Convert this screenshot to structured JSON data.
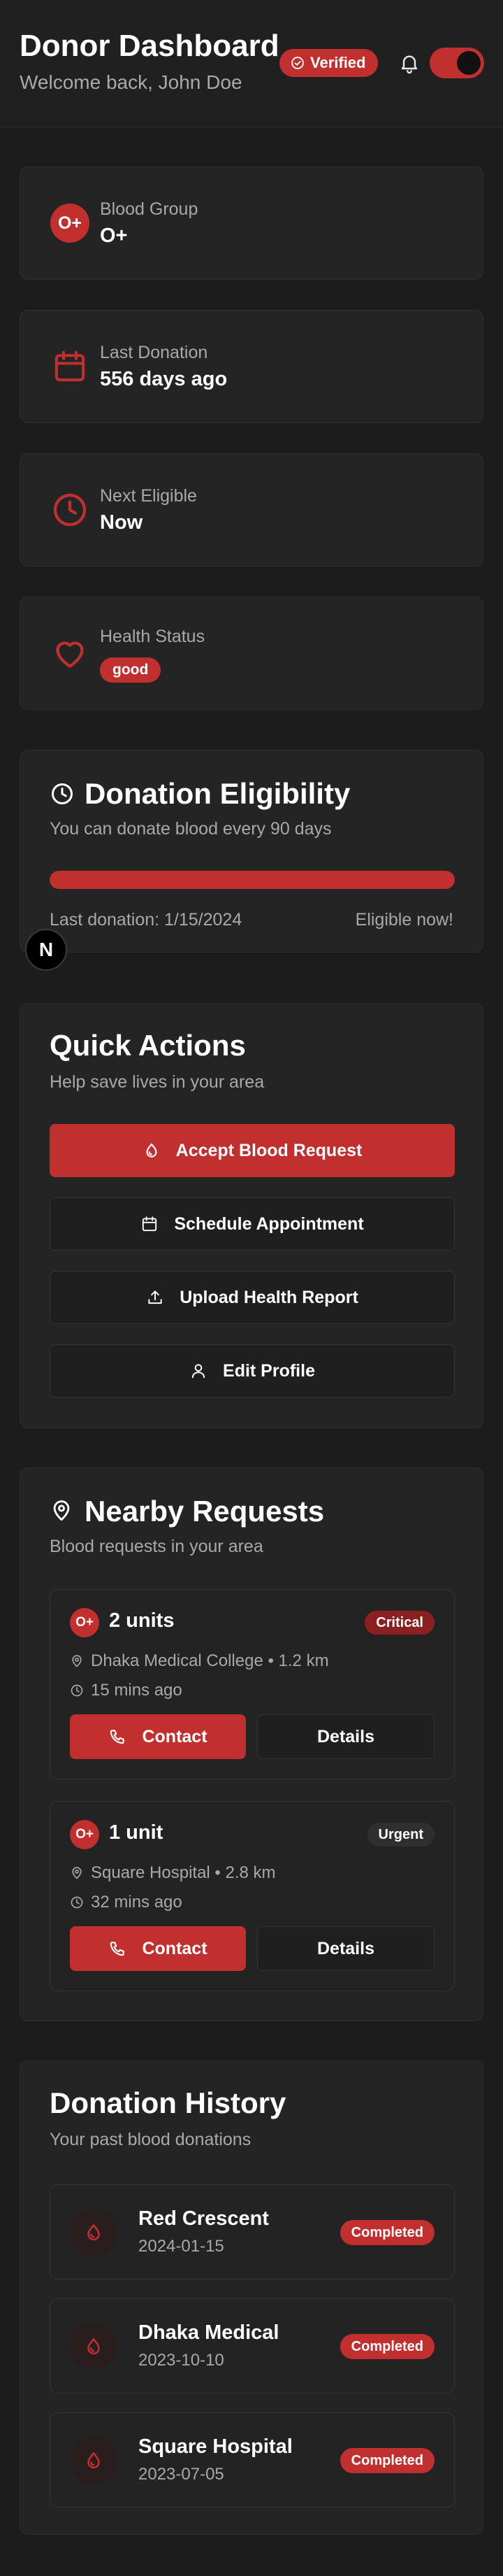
{
  "header": {
    "title": "Donor Dashboard",
    "welcome": "Welcome back, John Doe",
    "verified_label": "Verified",
    "notifications_icon": "bell-icon",
    "theme_toggle_on": true
  },
  "stats": {
    "blood_group": {
      "label": "Blood Group",
      "value": "O+",
      "badge": "O+"
    },
    "last_donation": {
      "label": "Last Donation",
      "value": "556 days ago",
      "icon": "calendar-icon"
    },
    "next_eligible": {
      "label": "Next Eligible",
      "value": "Now",
      "icon": "clock-icon"
    },
    "health_status": {
      "label": "Health Status",
      "value": "good",
      "icon": "heart-icon"
    }
  },
  "eligibility": {
    "title": "Donation Eligibility",
    "subtitle": "You can donate blood every 90 days",
    "progress": 1.0,
    "last_donation": "Last donation: 1/15/2024",
    "status": "Eligible now!"
  },
  "floating_badge": "N",
  "quick_actions": {
    "title": "Quick Actions",
    "subtitle": "Help save lives in your area",
    "actions": [
      {
        "label": "Accept Blood Request",
        "icon": "droplet-icon",
        "primary": true
      },
      {
        "label": "Schedule Appointment",
        "icon": "calendar-icon",
        "primary": false
      },
      {
        "label": "Upload Health Report",
        "icon": "upload-icon",
        "primary": false
      },
      {
        "label": "Edit Profile",
        "icon": "user-icon",
        "primary": false
      }
    ]
  },
  "nearby": {
    "title": "Nearby Requests",
    "subtitle": "Blood requests in your area",
    "requests": [
      {
        "blood": "O+",
        "units": "2 units",
        "urgency": "Critical",
        "location": "Dhaka Medical College • 1.2 km",
        "time": "15 mins ago",
        "contact": "Contact",
        "details": "Details"
      },
      {
        "blood": "O+",
        "units": "1 unit",
        "urgency": "Urgent",
        "location": "Square Hospital • 2.8 km",
        "time": "32 mins ago",
        "contact": "Contact",
        "details": "Details"
      }
    ]
  },
  "history": {
    "title": "Donation History",
    "subtitle": "Your past blood donations",
    "items": [
      {
        "name": "Red Crescent",
        "date": "2024-01-15",
        "status": "Completed"
      },
      {
        "name": "Dhaka Medical",
        "date": "2023-10-10",
        "status": "Completed"
      },
      {
        "name": "Square Hospital",
        "date": "2023-07-05",
        "status": "Completed"
      }
    ]
  },
  "colors": {
    "accent": "#c12f2f",
    "background": "#1c1c1c",
    "card": "#242424",
    "muted_text": "#a9a9a9"
  }
}
